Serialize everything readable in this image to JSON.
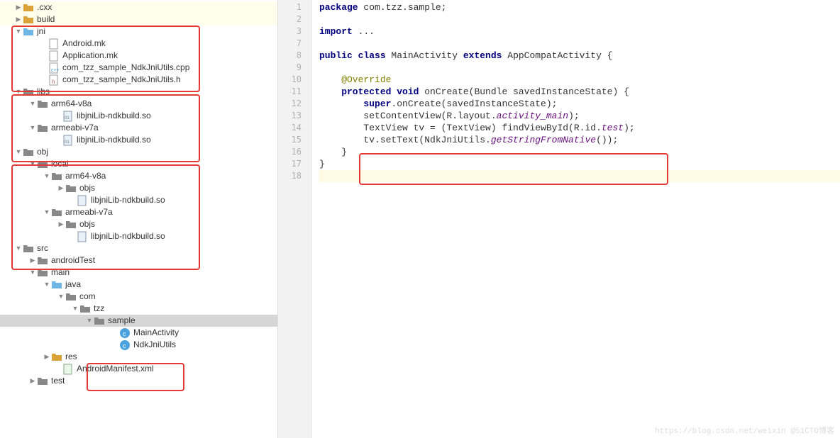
{
  "tree": {
    "n0": ".cxx",
    "n1": "build",
    "n2": "jni",
    "n3": "Android.mk",
    "n4": "Application.mk",
    "n5": "com_tzz_sample_NdkJniUtils.cpp",
    "n6": "com_tzz_sample_NdkJniUtils.h",
    "n7": "libs",
    "n8": "arm64-v8a",
    "n9": "libjniLib-ndkbuild.so",
    "n10": "armeabi-v7a",
    "n11": "libjniLib-ndkbuild.so",
    "n12": "obj",
    "n13": "local",
    "n14": "arm64-v8a",
    "n15": "objs",
    "n16": "libjniLib-ndkbuild.so",
    "n17": "armeabi-v7a",
    "n18": "objs",
    "n19": "libjniLib-ndkbuild.so",
    "n20": "src",
    "n21": "androidTest",
    "n22": "main",
    "n23": "java",
    "n24": "com",
    "n25": "tzz",
    "n26": "sample",
    "n27": "MainActivity",
    "n28": "NdkJniUtils",
    "n29": "res",
    "n30": "AndroidManifest.xml",
    "n31": "test"
  },
  "lines": {
    "l1": "1",
    "l2": "2",
    "l3": "3",
    "l7": "7",
    "l8": "8",
    "l9": "9",
    "l10": "10",
    "l11": "11",
    "l12": "12",
    "l13": "13",
    "l14": "14",
    "l15": "15",
    "l16": "16",
    "l17": "17",
    "l18": "18"
  },
  "code": {
    "c1a": "package ",
    "c1b": "com.tzz.sample;",
    "c3a": "import ",
    "c3b": "...",
    "c8a": "public class ",
    "c8b": "MainActivity ",
    "c8c": "extends ",
    "c8d": "AppCompatActivity {",
    "c10": "    @Override",
    "c11a": "    protected void ",
    "c11b": "onCreate(Bundle savedInstanceState) {",
    "c12a": "        super",
    "c12b": ".onCreate(savedInstanceState);",
    "c13a": "        setContentView(R.layout.",
    "c13b": "activity_main",
    "c13c": ");",
    "c14a": "        TextView tv = (TextView) findViewById(R.id.",
    "c14b": "test",
    "c14c": ");",
    "c15a": "        tv.setText(NdkJniUtils.",
    "c15b": "getStringFromNative",
    "c15c": "());",
    "c16": "    }",
    "c17": "}"
  },
  "watermark": "https://blog.csdn.net/weixin @51CTO博客"
}
